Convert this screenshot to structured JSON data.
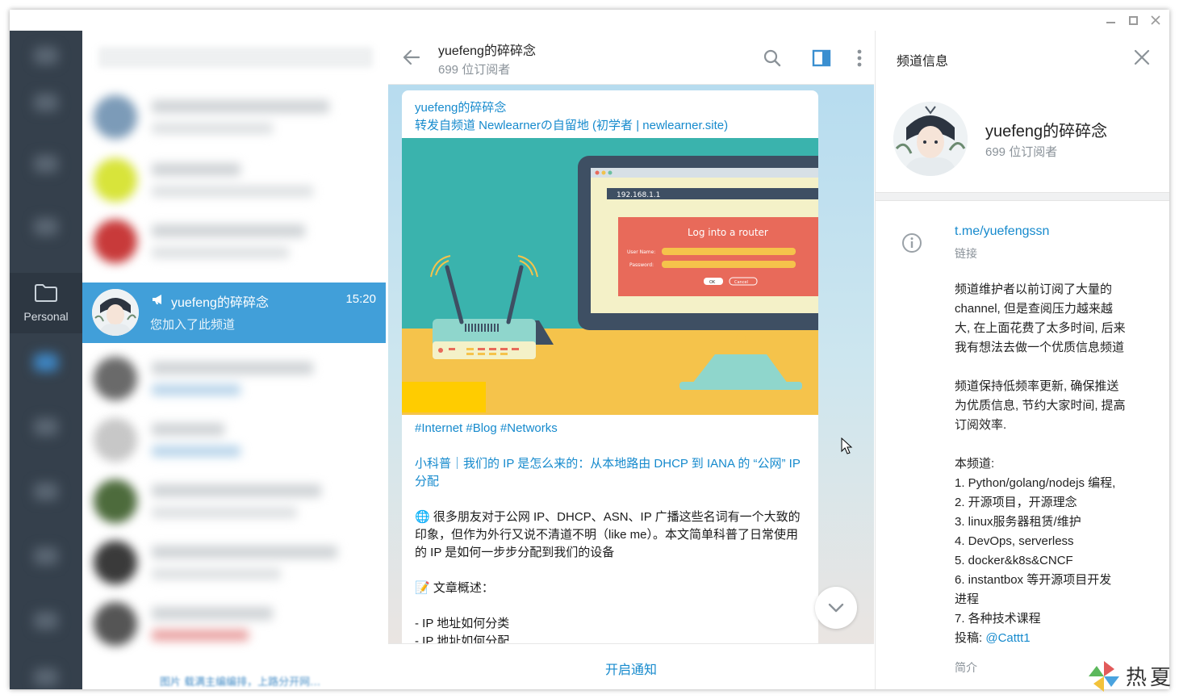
{
  "window": {
    "controls": [
      "minimize",
      "maximize",
      "close"
    ]
  },
  "folders": {
    "personal_label": "Personal"
  },
  "chat_list": {
    "active_chat": {
      "name": "yuefeng的碎碎念",
      "time": "15:20",
      "preview": "您加入了此频道"
    },
    "bottom_blurred_text": "图片   载满主编编排，上路分开网…"
  },
  "chat": {
    "title": "yuefeng的碎碎念",
    "subtitle": "699 位订阅者",
    "message": {
      "author": "yuefeng的碎碎念",
      "forwarded_from": "转发自频道 Newlearnerの自留地 (初学者 | newlearner.site)",
      "image": {
        "ip_text": "192.168.1.1",
        "dialog_title": "Log into a router",
        "user_label": "User Name:",
        "password_label": "Password:",
        "ok_label": "OK",
        "cancel_label": "Cancel"
      },
      "hashtags": "#Internet #Blog #Networks",
      "headline_link": "小科普｜我们的 IP 是怎么来的：从本地路由 DHCP 到 IANA 的 “公网” IP 分配",
      "paragraph_1": "🌐 很多朋友对于公网 IP、DHCP、ASN、IP 广播这些名词有一个大致的印象，但作为外行又说不清道不明（like me）。本文简单科普了日常使用的 IP 是如何一步步分配到我们的设备",
      "overview_label": "📝 文章概述：",
      "bullet_1": "- IP 地址如何分类",
      "bullet_2": "- IP 地址如何分配"
    },
    "footer_button": "开启通知"
  },
  "info_panel": {
    "title": "频道信息",
    "channel_name": "yuefeng的碎碎念",
    "subscribers": "699 位订阅者",
    "link": "t.me/yuefengssn",
    "link_label": "链接",
    "description_lines": [
      "频道维护者以前订阅了大量的",
      "channel, 但是查阅压力越来越",
      "大, 在上面花费了太多时间, 后来",
      "我有想法去做一个优质信息频道",
      "",
      "频道保持低频率更新, 确保推送",
      "为优质信息, 节约大家时间, 提高",
      "订阅效率.",
      "",
      "本频道:",
      "1. Python/golang/nodejs 编程,",
      "2. 开源项目，开源理念",
      "3. linux服务器租赁/维护",
      "4. DevOps, serverless",
      "5. docker&k8s&CNCF",
      "6. instantbox 等开源项目开发",
      "进程",
      "7. 各种技术课程"
    ],
    "submit_prefix": "投稿: ",
    "submit_link": "@Cattt1",
    "description_label": "简介"
  },
  "watermark": {
    "text": "热夏"
  },
  "colors": {
    "accent": "#419fd9",
    "link": "#168acd",
    "sidebar": "#35404c"
  }
}
